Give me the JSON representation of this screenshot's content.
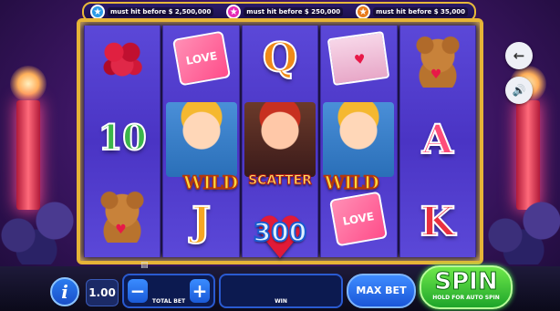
{
  "jackpots": [
    {
      "text": "must hit before $ 2,500,000",
      "color": "#2a9be8",
      "icon": "star-icon"
    },
    {
      "text": "must hit before $ 250,000",
      "color": "#e52ab5",
      "icon": "star-icon"
    },
    {
      "text": "must hit before $ 35,000",
      "color": "#e87a1a",
      "icon": "star-icon"
    }
  ],
  "reels": {
    "r1": [
      "roses",
      "10",
      "bear"
    ],
    "r2": [
      "love-card",
      "cupid-wild",
      "J"
    ],
    "r3": [
      "Q",
      "scatter",
      "300-heart"
    ],
    "r4": [
      "love-letter",
      "cupid-wild",
      "love-card"
    ],
    "r5": [
      "bear",
      "A",
      "K"
    ]
  },
  "symbols": {
    "ten": "10",
    "j": "J",
    "q": "Q",
    "a": "A",
    "k": "K",
    "wild_left": "WILD",
    "scatter": "SCATTER",
    "wild_right": "WILD",
    "prize": "300",
    "card": "LOVE"
  },
  "controls": {
    "info": "i",
    "bet_amount": "1.00",
    "minus": "−",
    "plus": "+",
    "total_bet_label": "TOTAL BET",
    "win_label": "WIN",
    "max_bet": "MAX BET",
    "spin": "SPIN",
    "spin_sub": "HOLD FOR AUTO SPIN"
  },
  "side_buttons": {
    "back": "←",
    "sound": "🔊"
  }
}
